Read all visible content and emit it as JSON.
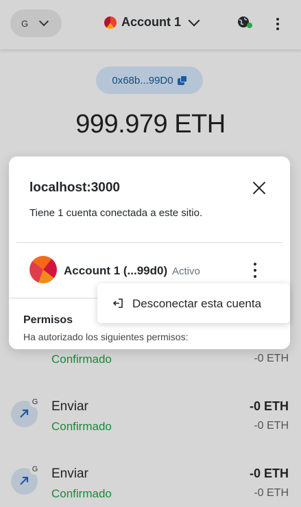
{
  "header": {
    "network_label": "G",
    "account_name": "Account 1"
  },
  "wallet": {
    "address_short": "0x68b...99D0",
    "balance": "999.979 ETH"
  },
  "transactions": [
    {
      "title": "",
      "status": "Confirmado",
      "amount": "",
      "fiat": "-0 ETH",
      "badge": ""
    },
    {
      "title": "Enviar",
      "status": "Confirmado",
      "amount": "-0 ETH",
      "fiat": "-0 ETH",
      "badge": "G"
    },
    {
      "title": "Enviar",
      "status": "Confirmado",
      "amount": "-0 ETH",
      "fiat": "-0 ETH",
      "badge": "G"
    }
  ],
  "modal": {
    "title": "localhost:3000",
    "subtitle": "Tiene 1 cuenta conectada a este sitio.",
    "account_name": "Account 1 (...99d0)",
    "account_status": "Activo",
    "permissions_title": "Permisos",
    "permissions_subtitle": "Ha autorizado los siguientes permisos:",
    "dropdown_disconnect": "Desconectar esta cuenta"
  },
  "colors": {
    "confirmed": "#1a8a3c",
    "address_bg": "#b6c5d6",
    "connected_dot": "#28a745"
  },
  "icons": [
    "chevron-down-icon",
    "globe-icon",
    "kebab-icon",
    "copy-icon",
    "close-icon",
    "arrow-up-right-icon",
    "disconnect-icon"
  ]
}
